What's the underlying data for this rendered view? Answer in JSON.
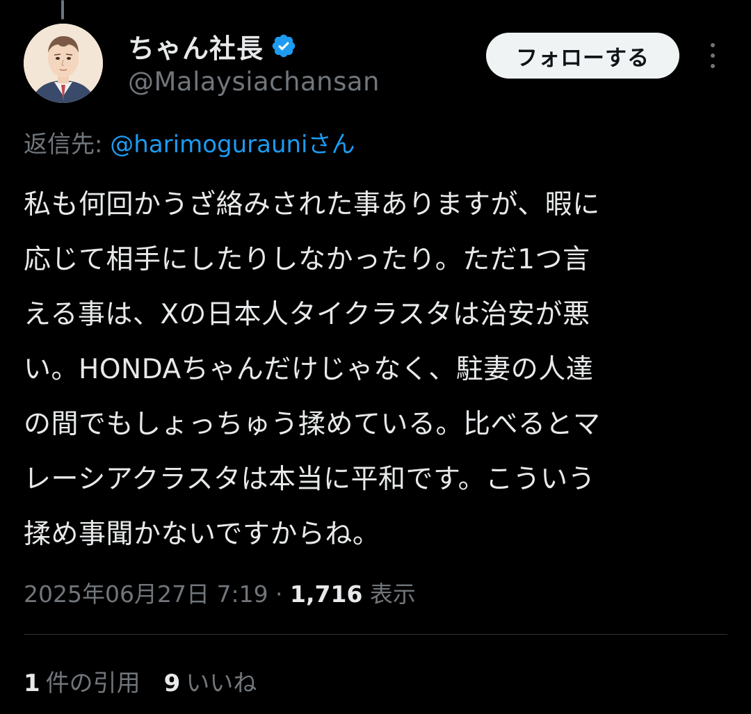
{
  "author": {
    "display_name": "ちゃん社長",
    "handle": "@Malaysiachansan",
    "verified_color": "#1d9bf0"
  },
  "follow_button": {
    "label": "フォローする"
  },
  "more_button": {
    "icon": "more-vertical-icon"
  },
  "reply_to": {
    "prefix": "返信先: ",
    "mention": "@harimogurauniさん"
  },
  "tweet": {
    "lines": [
      "私も何回かうざ絡みされた事ありますが、暇に",
      "応じて相手にしたりしなかったり。ただ1つ言",
      "える事は、Xの日本人タイクラスタは治安が悪",
      "い。HONDAちゃんだけじゃなく、駐妻の人達",
      "の間でもしょっちゅう揉めている。比べるとマ",
      "レーシアクラスタは本当に平和です。こういう",
      "揉め事聞かないですからね。"
    ]
  },
  "meta": {
    "timestamp": "2025年06月27日 7:19",
    "separator": " · ",
    "views_count": "1,716",
    "views_label": " 表示"
  },
  "stats": {
    "quotes_count": "1",
    "quotes_label": "件の引用",
    "likes_count": "9",
    "likes_label": "いいね"
  },
  "colors": {
    "background": "#000000",
    "text_primary": "#e7e9ea",
    "text_secondary": "#71767b",
    "link": "#1d9bf0",
    "divider": "#2f3336"
  }
}
